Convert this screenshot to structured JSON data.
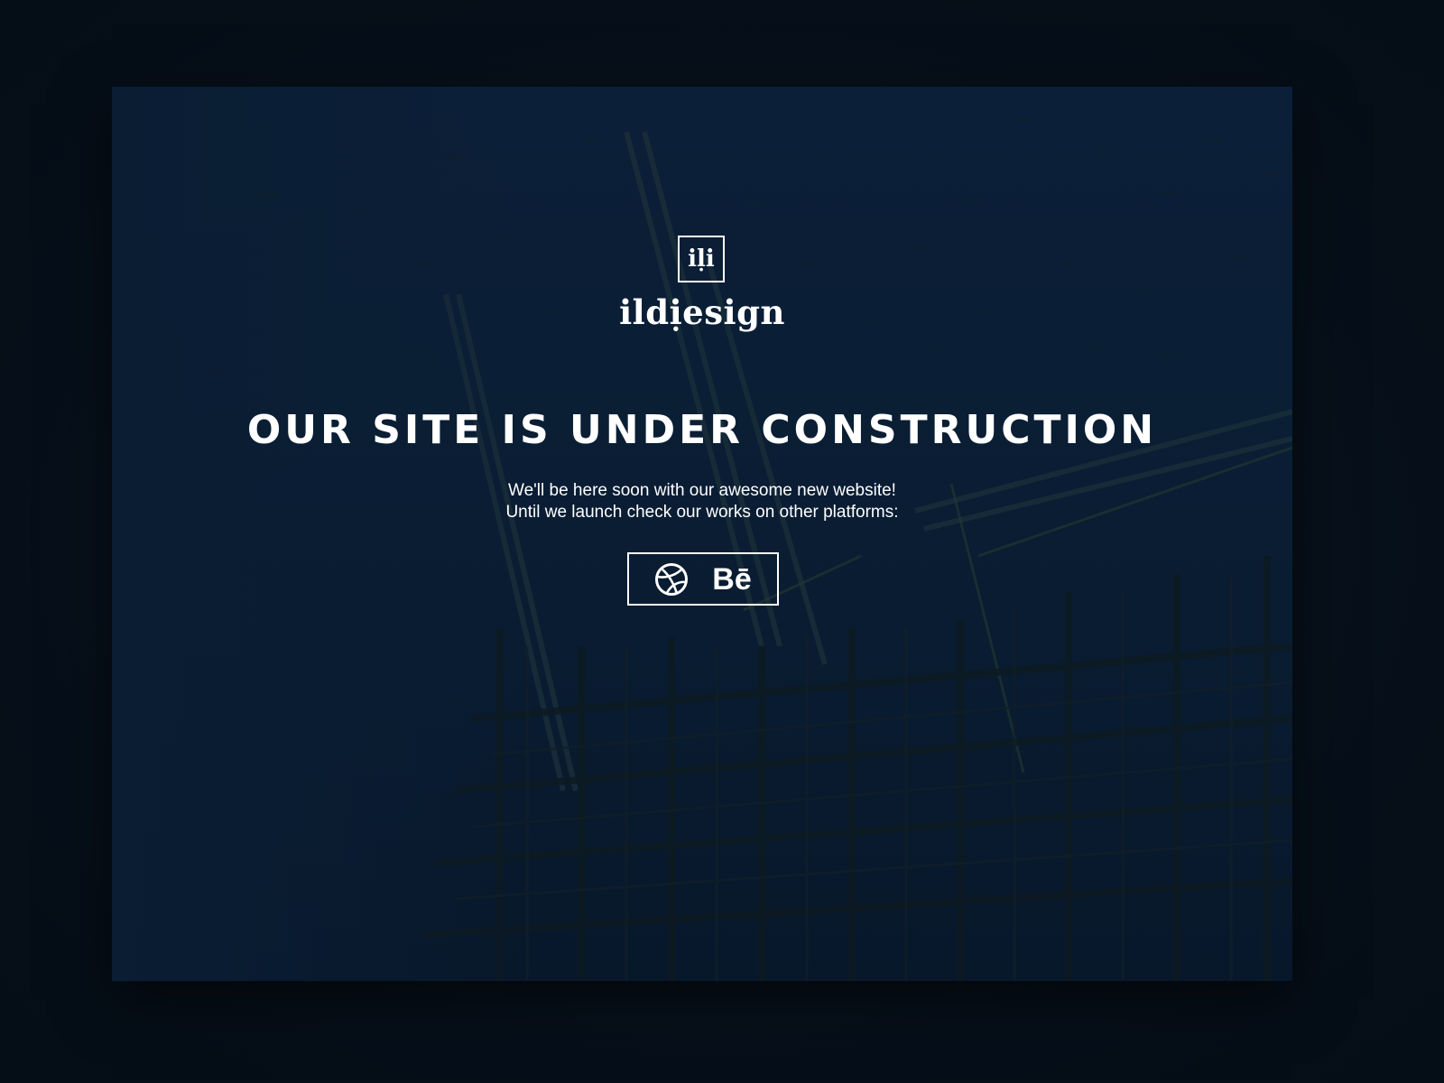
{
  "brand": {
    "mark": "iḷi",
    "wordmark": "ildịesign"
  },
  "headline": "OUR SITE IS UNDER CONSTRUCTION",
  "message": {
    "line1": "We'll be here soon with our awesome new website!",
    "line2": "Until we launch check our works on other platforms:"
  },
  "platforms": {
    "dribbble_icon": "dribbble-icon",
    "behance_label": "Bē"
  },
  "colors": {
    "background": "#060f19",
    "card": "#0b1f38",
    "text": "#ffffff"
  }
}
